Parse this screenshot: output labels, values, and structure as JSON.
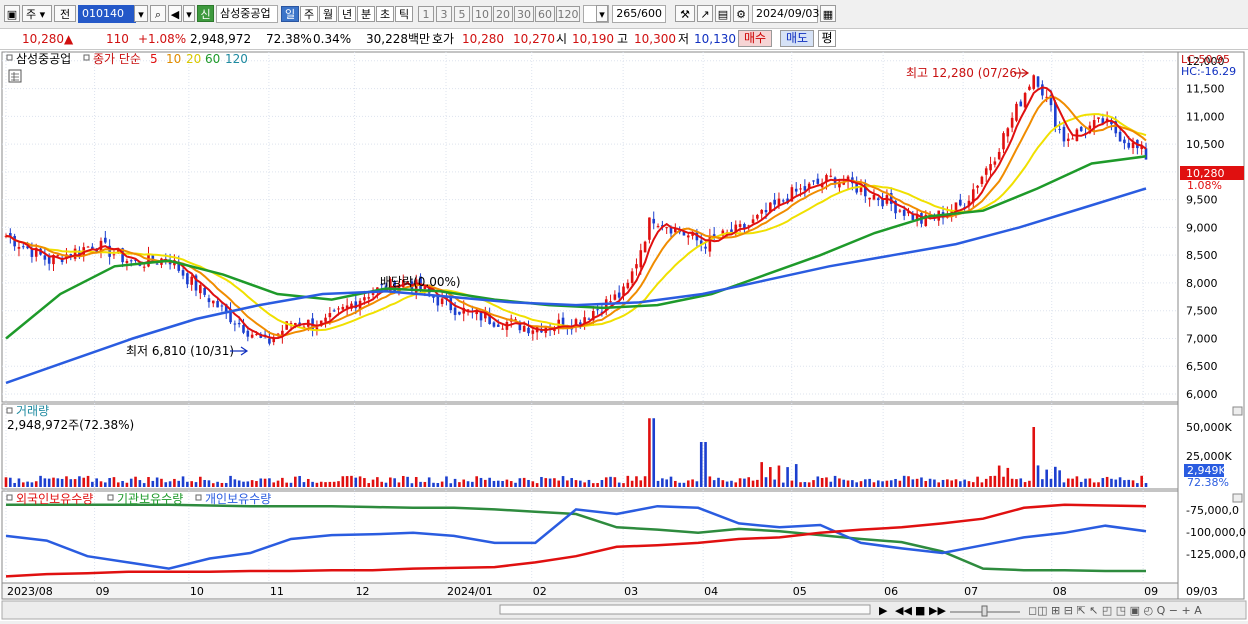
{
  "toolbar": {
    "market": "주",
    "market2": "전",
    "code": "010140",
    "badge_new": "신",
    "stock_name": "삼성중공업",
    "periods": [
      "일",
      "주",
      "월",
      "년",
      "분",
      "초",
      "틱"
    ],
    "active_period": "일",
    "intervals": [
      "1",
      "3",
      "5",
      "10",
      "20",
      "30",
      "60",
      "120"
    ],
    "count": "265",
    "count_total": "/600",
    "date": "2024/09/03"
  },
  "quote": {
    "price": "10,280",
    "arrow": "▲",
    "change": "110",
    "change_pct": "+1.08%",
    "volume": "2,948,972",
    "volume_ratio": "72.38%",
    "turnover": "0.34%",
    "amount": "30,228백만",
    "bid_label": "호가",
    "bid1": "10,280",
    "bid2": "10,270",
    "open_label": "시",
    "open": "10,190",
    "high_label": "고",
    "high": "10,300",
    "low_label": "저",
    "low": "10,130",
    "buy": "매수",
    "sell": "매도",
    "avg": "평"
  },
  "legend": {
    "name": "삼성중공업",
    "ma_label": "종가 단순",
    "ma5": "5",
    "ma10": "10",
    "ma20": "20",
    "ma60": "60",
    "ma120": "120"
  },
  "colors": {
    "ma5": "#e01010",
    "ma10": "#f08c00",
    "ma20": "#f0e000",
    "ma60": "#1e9a2a",
    "ma120": "#2a5ce0",
    "up": "#e01010",
    "down": "#1c3fcf",
    "foreign": "#2a5ce0",
    "inst": "#2e8b3e",
    "indiv": "#e01010"
  },
  "chart_data": [
    {
      "type": "candlestick",
      "title": "삼성중공업",
      "x_ticks": [
        "2023/08",
        "09",
        "10",
        "11",
        "12",
        "2024/01",
        "02",
        "03",
        "04",
        "05",
        "06",
        "07",
        "08",
        "09"
      ],
      "y_ticks": [
        6000,
        6500,
        7000,
        7500,
        8000,
        8500,
        9000,
        9500,
        10000,
        10500,
        11000,
        11500,
        12000
      ],
      "ylim": [
        6000,
        12000
      ],
      "last_price": "10,280",
      "last_pct": "1.08%",
      "lc": "LC:50.95",
      "hc": "HC:-16.29",
      "annotations": {
        "high": "최고 12,280 (07/26)",
        "low": "최저 6,810 (10/31)",
        "dividend": "배당락(0.00%)"
      },
      "series_close": [
        {
          "date": "2023-08-01",
          "close": 8850
        },
        {
          "date": "2023-08-16",
          "close": 8400
        },
        {
          "date": "2023-09-01",
          "close": 8700
        },
        {
          "date": "2023-09-15",
          "close": 8350
        },
        {
          "date": "2023-09-27",
          "close": 8450
        },
        {
          "date": "2023-10-05",
          "close": 8000
        },
        {
          "date": "2023-10-17",
          "close": 7450
        },
        {
          "date": "2023-10-31",
          "close": 6900
        },
        {
          "date": "2023-11-09",
          "close": 7300
        },
        {
          "date": "2023-11-20",
          "close": 7250
        },
        {
          "date": "2023-12-05",
          "close": 7800
        },
        {
          "date": "2023-12-19",
          "close": 8050
        },
        {
          "date": "2024-01-02",
          "close": 7600
        },
        {
          "date": "2024-01-17",
          "close": 7350
        },
        {
          "date": "2024-02-01",
          "close": 7200
        },
        {
          "date": "2024-02-16",
          "close": 7300
        },
        {
          "date": "2024-03-05",
          "close": 7850
        },
        {
          "date": "2024-03-14",
          "close": 9200
        },
        {
          "date": "2024-04-01",
          "close": 8700
        },
        {
          "date": "2024-04-16",
          "close": 9000
        },
        {
          "date": "2024-05-02",
          "close": 9600
        },
        {
          "date": "2024-05-17",
          "close": 9900
        },
        {
          "date": "2024-06-03",
          "close": 9500
        },
        {
          "date": "2024-06-17",
          "close": 9100
        },
        {
          "date": "2024-07-01",
          "close": 9400
        },
        {
          "date": "2024-07-12",
          "close": 10300
        },
        {
          "date": "2024-07-26",
          "close": 11800
        },
        {
          "date": "2024-08-05",
          "close": 10600
        },
        {
          "date": "2024-08-19",
          "close": 10900
        },
        {
          "date": "2024-09-03",
          "close": 10280
        }
      ],
      "ma": {
        "ma60": [
          7000,
          7800,
          8300,
          8400,
          8150,
          7800,
          7700,
          7900,
          7850,
          7700,
          7600,
          7550,
          7600,
          7800,
          8150,
          8500,
          8900,
          9200,
          9300,
          9700,
          10150,
          10280
        ],
        "ma120": [
          6200,
          6600,
          7000,
          7350,
          7600,
          7800,
          7850,
          7750,
          7650,
          7600,
          7650,
          7800,
          8050,
          8300,
          8500,
          8700,
          9000,
          9350,
          9700
        ]
      }
    },
    {
      "type": "bar",
      "title": "거래량",
      "value_label": "2,948,972주(72.38%)",
      "y_ticks": [
        "50,000K",
        "25,000K"
      ],
      "last": "2,949K",
      "last_pct": "72.38%",
      "peaks": [
        {
          "date": "2024-03-14",
          "value": 55000
        },
        {
          "date": "2024-07-26",
          "value": 38000
        },
        {
          "date": "2024-04-01",
          "value": 36000
        }
      ]
    },
    {
      "type": "line",
      "title": "외국인보유수량",
      "series_names": [
        "외국인보유수량",
        "기관보유수량",
        "개인보유수량"
      ],
      "y_ticks": [
        "-75,000,0",
        "-100,000,0",
        "-125,000,0"
      ]
    }
  ],
  "bottom": {
    "x_end": "09/03"
  }
}
